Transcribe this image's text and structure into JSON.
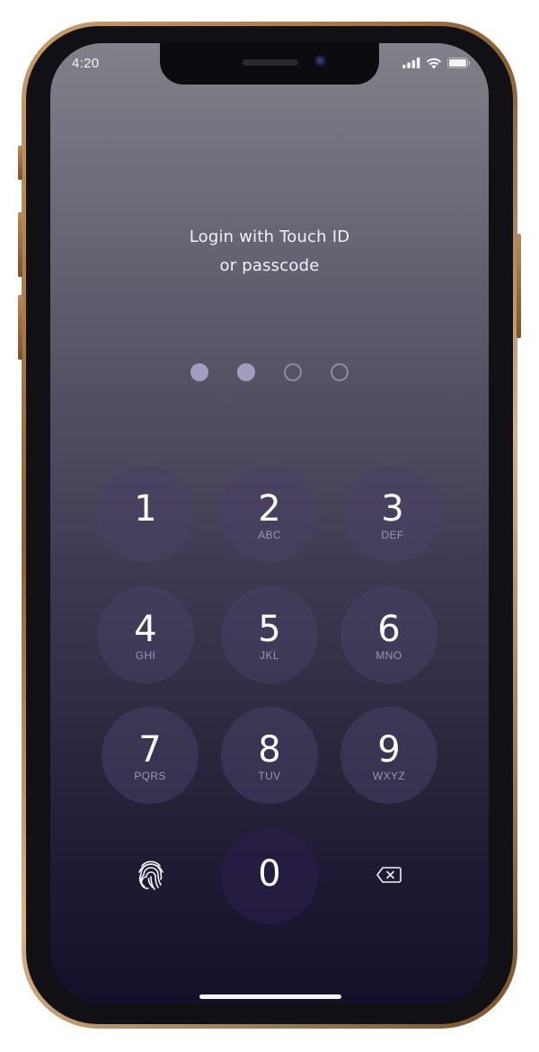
{
  "status_bar": {
    "time": "4:20",
    "icons": [
      "signal-icon",
      "wifi-icon",
      "battery-icon"
    ]
  },
  "prompt": {
    "line1": "Login with Touch ID",
    "line2": "or passcode"
  },
  "passcode": {
    "length": 4,
    "entered": 2
  },
  "keypad": {
    "keys": [
      {
        "digit": "1",
        "letters": ""
      },
      {
        "digit": "2",
        "letters": "ABC"
      },
      {
        "digit": "3",
        "letters": "DEF"
      },
      {
        "digit": "4",
        "letters": "GHI"
      },
      {
        "digit": "5",
        "letters": "JKL"
      },
      {
        "digit": "6",
        "letters": "MNO"
      },
      {
        "digit": "7",
        "letters": "PQRS"
      },
      {
        "digit": "8",
        "letters": "TUV"
      },
      {
        "digit": "9",
        "letters": "WXYZ"
      },
      {
        "digit": "0",
        "letters": ""
      }
    ],
    "touch_id_icon": "fingerprint-icon",
    "delete_icon": "delete-backspace-icon"
  },
  "colors": {
    "dot_filled": "#a39ebd",
    "dot_empty_border": "#8f8aa6",
    "frame_gold": "#b8885a"
  }
}
